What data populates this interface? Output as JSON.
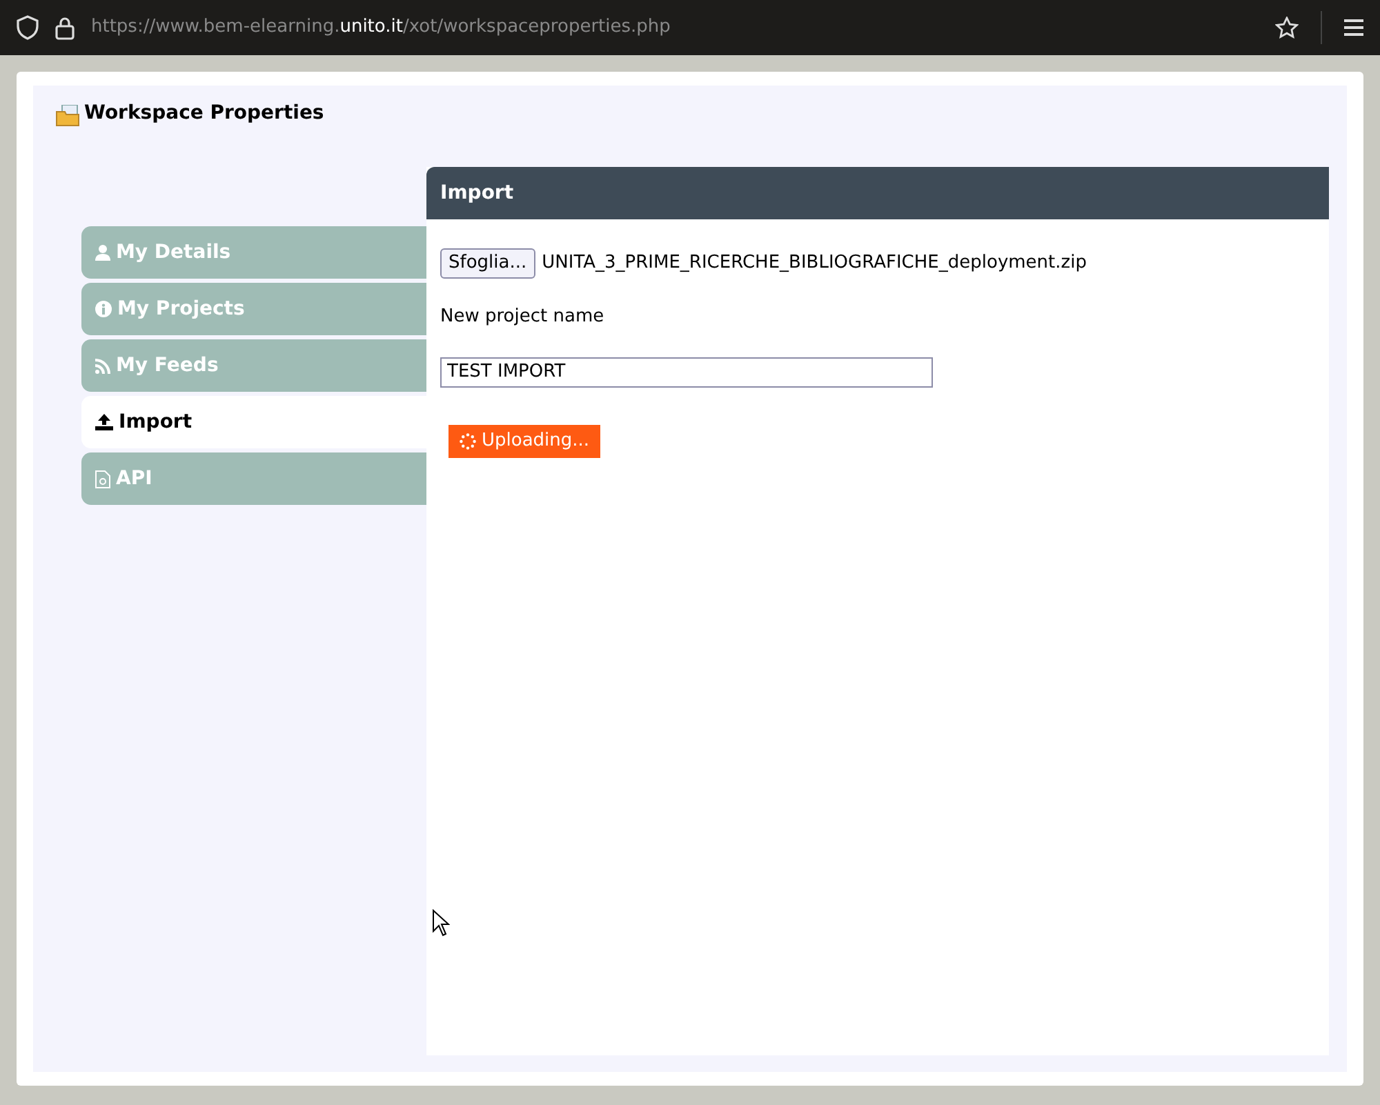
{
  "browser": {
    "url": [
      {
        "text": "https://www.bem-elearning.",
        "highlight": false
      },
      {
        "text": "unito.it",
        "highlight": true
      },
      {
        "text": "/xot/workspaceproperties.php",
        "highlight": false
      }
    ]
  },
  "page_title": "Workspace Properties",
  "tabs": [
    {
      "label": "My Details",
      "selected": false
    },
    {
      "label": "My Projects",
      "selected": false
    },
    {
      "label": "My Feeds",
      "selected": false
    },
    {
      "label": "Import",
      "selected": true
    },
    {
      "label": "API",
      "selected": false
    }
  ],
  "panel": {
    "title": "Import",
    "browse_button": "Sfoglia...",
    "file_name": "UNITA_3_PRIME_RICERCHE_BIBLIOGRAFICHE_deployment.zip",
    "name_label": "New project name",
    "name_value": "TEST IMPORT",
    "upload_button": "Uploading..."
  }
}
